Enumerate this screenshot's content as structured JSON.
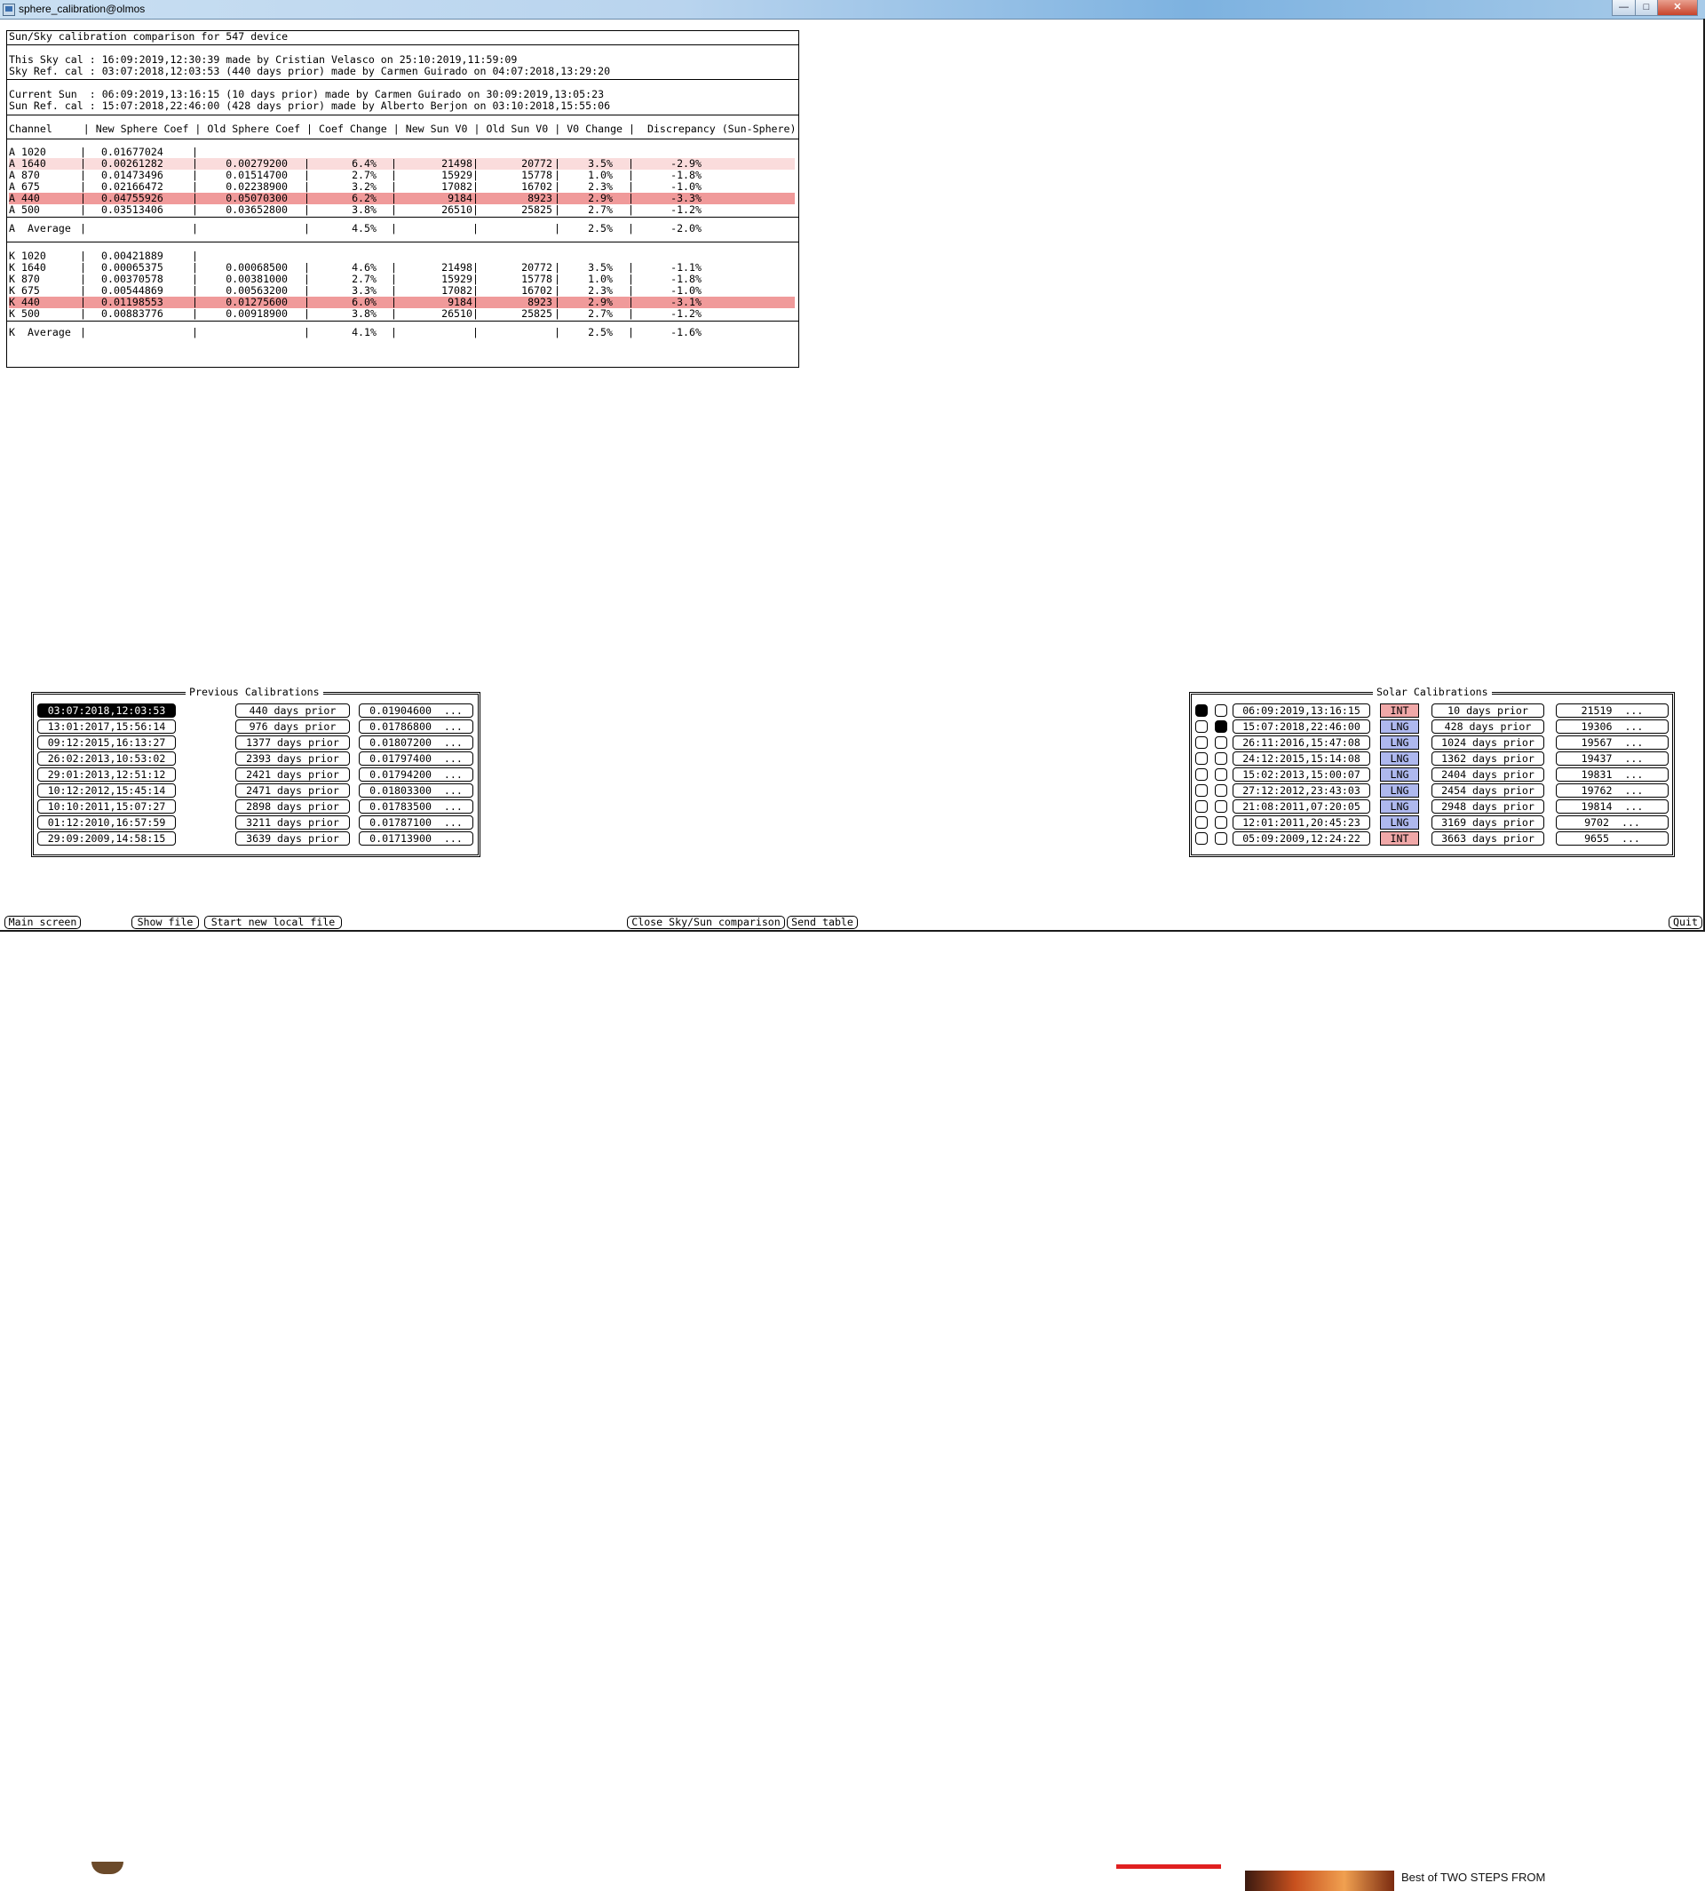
{
  "window": {
    "title": "sphere_calibration@olmos",
    "min_glyph": "—",
    "max_glyph": "□",
    "close_glyph": "✕"
  },
  "comparison": {
    "title": "Sun/Sky calibration comparison for 547 device",
    "sky_cal": "This Sky cal : 16:09:2019,12:30:39 made by Cristian Velasco on 25:10:2019,11:59:09",
    "sky_ref": "Sky Ref. cal : 03:07:2018,12:03:53 (440 days prior) made by Carmen Guirado on 04:07:2018,13:29:20",
    "current_sun": "Current Sun  : 06:09:2019,13:16:15 (10 days prior) made by Carmen Guirado on 30:09:2019,13:05:23",
    "sun_ref": "Sun Ref. cal : 15:07:2018,22:46:00 (428 days prior) made by Alberto Berjon on 03:10:2018,15:55:06",
    "header": "Channel     | New Sphere Coef | Old Sphere Coef | Coef Change | New Sun V0 | Old Sun V0 | V0 Change |  Discrepancy (Sun-Sphere)",
    "a_rows": [
      {
        "ch": "A 1020",
        "new": "0.01677024",
        "old": "",
        "cc": "",
        "nv": "",
        "ov": "",
        "vc": "",
        "d": ""
      },
      {
        "ch": "A 1640",
        "new": "0.00261282",
        "old": "0.00279200",
        "cc": "6.4%",
        "nv": "21498",
        "ov": "20772",
        "vc": "3.5%",
        "d": "-2.9%"
      },
      {
        "ch": "A 870",
        "new": "0.01473496",
        "old": "0.01514700",
        "cc": "2.7%",
        "nv": "15929",
        "ov": "15778",
        "vc": "1.0%",
        "d": "-1.8%"
      },
      {
        "ch": "A 675",
        "new": "0.02166472",
        "old": "0.02238900",
        "cc": "3.2%",
        "nv": "17082",
        "ov": "16702",
        "vc": "2.3%",
        "d": "-1.0%"
      },
      {
        "ch": "A 440",
        "new": "0.04755926",
        "old": "0.05070300",
        "cc": "6.2%",
        "nv": "9184",
        "ov": "8923",
        "vc": "2.9%",
        "d": "-3.3%"
      },
      {
        "ch": "A 500",
        "new": "0.03513406",
        "old": "0.03652800",
        "cc": "3.8%",
        "nv": "26510",
        "ov": "25825",
        "vc": "2.7%",
        "d": "-1.2%"
      }
    ],
    "a_avg": {
      "ch": "A  Average",
      "cc": "4.5%",
      "vc": "2.5%",
      "d": "-2.0%"
    },
    "k_rows": [
      {
        "ch": "K 1020",
        "new": "0.00421889",
        "old": "",
        "cc": "",
        "nv": "",
        "ov": "",
        "vc": "",
        "d": ""
      },
      {
        "ch": "K 1640",
        "new": "0.00065375",
        "old": "0.00068500",
        "cc": "4.6%",
        "nv": "21498",
        "ov": "20772",
        "vc": "3.5%",
        "d": "-1.1%"
      },
      {
        "ch": "K 870",
        "new": "0.00370578",
        "old": "0.00381000",
        "cc": "2.7%",
        "nv": "15929",
        "ov": "15778",
        "vc": "1.0%",
        "d": "-1.8%"
      },
      {
        "ch": "K 675",
        "new": "0.00544869",
        "old": "0.00563200",
        "cc": "3.3%",
        "nv": "17082",
        "ov": "16702",
        "vc": "2.3%",
        "d": "-1.0%"
      },
      {
        "ch": "K 440",
        "new": "0.01198553",
        "old": "0.01275600",
        "cc": "6.0%",
        "nv": "9184",
        "ov": "8923",
        "vc": "2.9%",
        "d": "-3.1%"
      },
      {
        "ch": "K 500",
        "new": "0.00883776",
        "old": "0.00918900",
        "cc": "3.8%",
        "nv": "26510",
        "ov": "25825",
        "vc": "2.7%",
        "d": "-1.2%"
      }
    ],
    "k_avg": {
      "ch": "K  Average",
      "cc": "4.1%",
      "vc": "2.5%",
      "d": "-1.6%"
    },
    "highlight_colors": {
      "light": "#fadcdc",
      "strong": "#f09a9a"
    }
  },
  "previous": {
    "title": "Previous Calibrations",
    "items": [
      {
        "date": "03:07:2018,12:03:53",
        "prior": "440 days prior",
        "coef": "0.01904600  ...",
        "selected": true
      },
      {
        "date": "13:01:2017,15:56:14",
        "prior": "976 days prior",
        "coef": "0.01786800  ...",
        "selected": false
      },
      {
        "date": "09:12:2015,16:13:27",
        "prior": "1377 days prior",
        "coef": "0.01807200  ...",
        "selected": false
      },
      {
        "date": "26:02:2013,10:53:02",
        "prior": "2393 days prior",
        "coef": "0.01797400  ...",
        "selected": false
      },
      {
        "date": "29:01:2013,12:51:12",
        "prior": "2421 days prior",
        "coef": "0.01794200  ...",
        "selected": false
      },
      {
        "date": "10:12:2012,15:45:14",
        "prior": "2471 days prior",
        "coef": "0.01803300  ...",
        "selected": false
      },
      {
        "date": "10:10:2011,15:07:27",
        "prior": "2898 days prior",
        "coef": "0.01783500  ...",
        "selected": false
      },
      {
        "date": "01:12:2010,16:57:59",
        "prior": "3211 days prior",
        "coef": "0.01787100  ...",
        "selected": false
      },
      {
        "date": "29:09:2009,14:58:15",
        "prior": "3639 days prior",
        "coef": "0.01713900  ...",
        "selected": false
      }
    ]
  },
  "solar": {
    "title": "Solar Calibrations",
    "items": [
      {
        "c1": true,
        "c2": false,
        "date": "06:09:2019,13:16:15",
        "type": "INT",
        "prior": "10 days prior",
        "v0": "21519  ..."
      },
      {
        "c1": false,
        "c2": true,
        "date": "15:07:2018,22:46:00",
        "type": "LNG",
        "prior": "428 days prior",
        "v0": "19306  ..."
      },
      {
        "c1": false,
        "c2": false,
        "date": "26:11:2016,15:47:08",
        "type": "LNG",
        "prior": "1024 days prior",
        "v0": "19567  ..."
      },
      {
        "c1": false,
        "c2": false,
        "date": "24:12:2015,15:14:08",
        "type": "LNG",
        "prior": "1362 days prior",
        "v0": "19437  ..."
      },
      {
        "c1": false,
        "c2": false,
        "date": "15:02:2013,15:00:07",
        "type": "LNG",
        "prior": "2404 days prior",
        "v0": "19831  ..."
      },
      {
        "c1": false,
        "c2": false,
        "date": "27:12:2012,23:43:03",
        "type": "LNG",
        "prior": "2454 days prior",
        "v0": "19762  ..."
      },
      {
        "c1": false,
        "c2": false,
        "date": "21:08:2011,07:20:05",
        "type": "LNG",
        "prior": "2948 days prior",
        "v0": "19814  ..."
      },
      {
        "c1": false,
        "c2": false,
        "date": "12:01:2011,20:45:23",
        "type": "LNG",
        "prior": "3169 days prior",
        "v0": "9702  ..."
      },
      {
        "c1": false,
        "c2": false,
        "date": "05:09:2009,12:24:22",
        "type": "INT",
        "prior": "3663 days prior",
        "v0": "9655  ..."
      }
    ],
    "colors": {
      "LNG": "#aeb8ee",
      "INT": "#f0a8a8"
    }
  },
  "buttons": {
    "main_screen": "Main screen",
    "show_file": "Show file",
    "start_new_local_file": "Start new local file",
    "close_comparison": "Close Sky/Sun comparison",
    "send_table": "Send table",
    "quit": "Quit"
  },
  "background_window": {
    "title_line": "Best of TWO STEPS FROM"
  }
}
